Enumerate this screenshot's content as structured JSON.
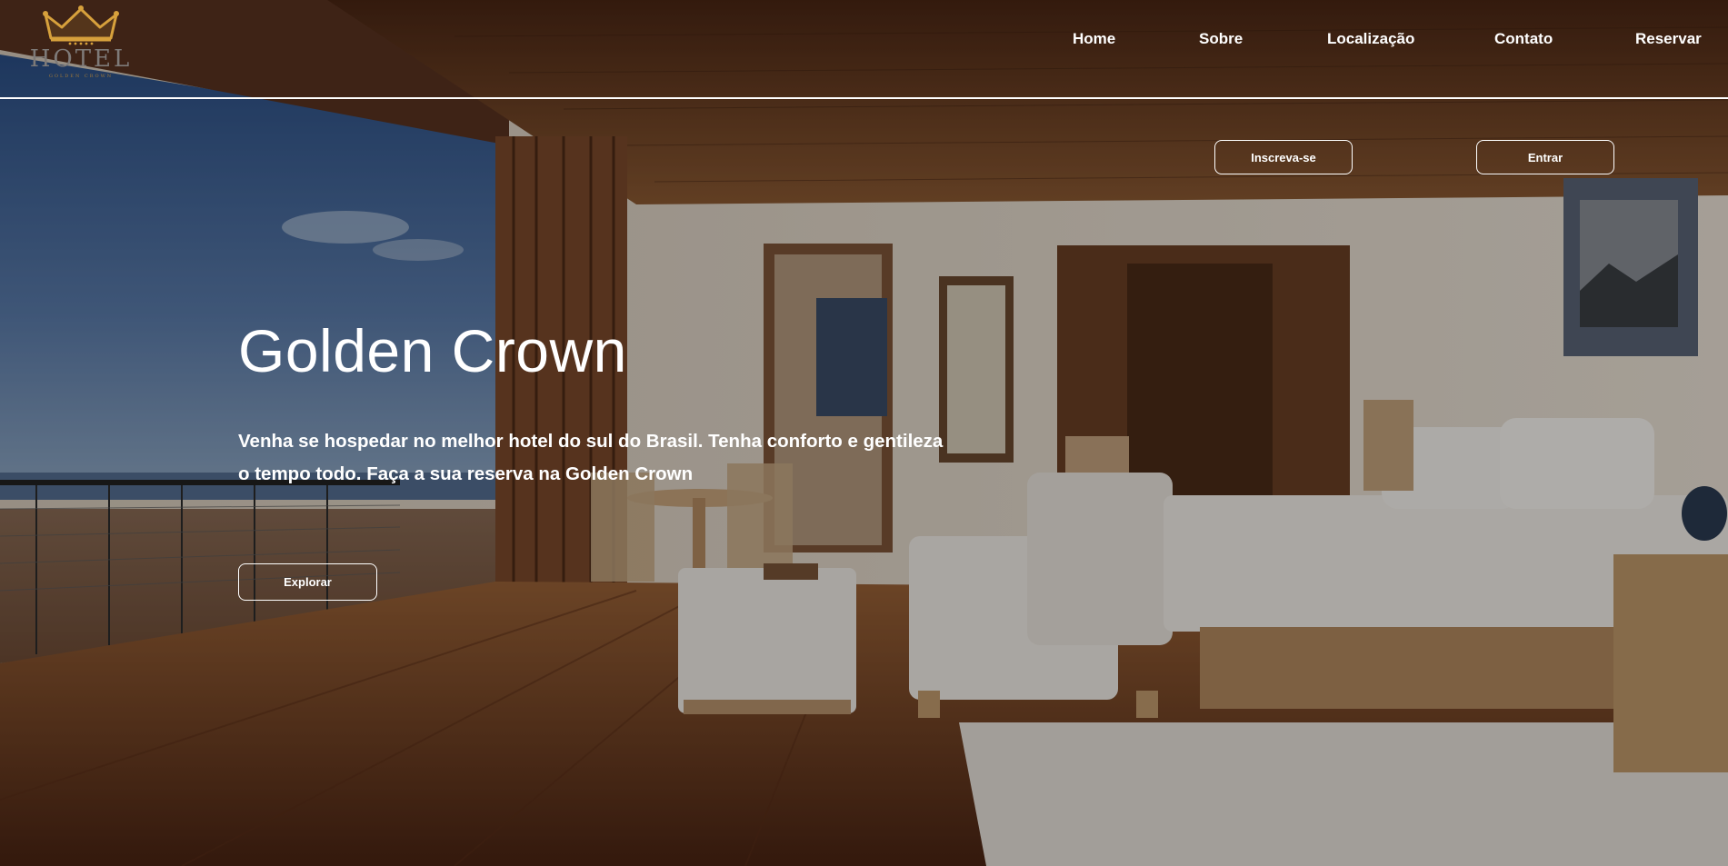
{
  "brand": {
    "logo_text": "HOTEL",
    "logo_subtext": "GOLDEN CROWN",
    "logo_icon": "crown-icon",
    "logo_color": "#d7a13c"
  },
  "nav": {
    "items": [
      {
        "label": "Home"
      },
      {
        "label": "Sobre"
      },
      {
        "label": "Localização"
      },
      {
        "label": "Contato"
      },
      {
        "label": "Reservar"
      }
    ]
  },
  "auth": {
    "signup_label": "Inscreva-se",
    "login_label": "Entrar"
  },
  "hero": {
    "title": "Golden Crown",
    "description": "Venha se hospedar no melhor hotel do sul do Brasil. Tenha conforto e gentileza o tempo todo. Faça a sua reserva na Golden Crown",
    "cta_label": "Explorar"
  },
  "colors": {
    "text": "#ffffff",
    "overlay": "rgba(0,0,0,0.30)",
    "wood": "#6b3b22"
  }
}
